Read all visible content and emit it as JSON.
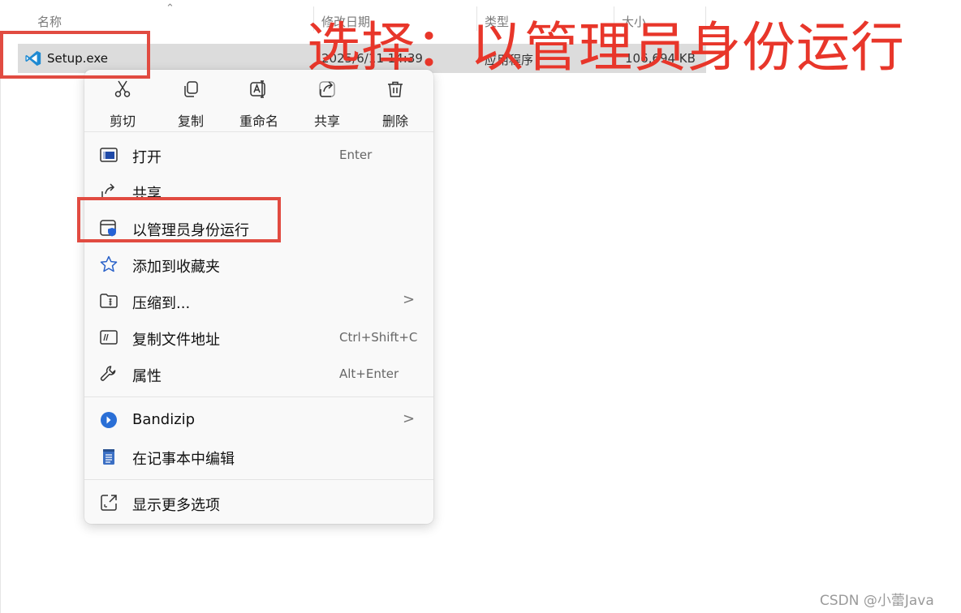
{
  "columns": {
    "name": "名称",
    "modified": "修改日期",
    "type": "类型",
    "size": "大小"
  },
  "file": {
    "name": "Setup.exe",
    "modified": "2025/6/11 14:39",
    "type": "应用程序",
    "size": "106,694 KB",
    "icon": "vscode-icon"
  },
  "annotation": "选择：以管理员身份运行",
  "quick_actions": [
    {
      "label": "剪切",
      "icon": "cut-icon"
    },
    {
      "label": "复制",
      "icon": "copy-icon"
    },
    {
      "label": "重命名",
      "icon": "rename-icon"
    },
    {
      "label": "共享",
      "icon": "share-icon"
    },
    {
      "label": "删除",
      "icon": "delete-icon"
    }
  ],
  "menu_items": [
    {
      "label": "打开",
      "shortcut": "Enter",
      "icon": "open-icon"
    },
    {
      "label": "共享",
      "shortcut": "",
      "icon": "share-icon"
    },
    {
      "label": "以管理员身份运行",
      "shortcut": "",
      "icon": "admin-shield-icon"
    },
    {
      "label": "添加到收藏夹",
      "shortcut": "",
      "icon": "star-icon"
    },
    {
      "label": "压缩到...",
      "shortcut": "",
      "icon": "zip-folder-icon",
      "submenu": ">"
    },
    {
      "label": "复制文件地址",
      "shortcut": "Ctrl+Shift+C",
      "icon": "copy-path-icon"
    },
    {
      "label": "属性",
      "shortcut": "Alt+Enter",
      "icon": "wrench-icon"
    },
    {
      "label": "Bandizip",
      "shortcut": "",
      "icon": "bandizip-icon",
      "submenu": ">"
    },
    {
      "label": "在记事本中编辑",
      "shortcut": "",
      "icon": "notepad-icon"
    },
    {
      "label": "显示更多选项",
      "shortcut": "",
      "icon": "more-options-icon"
    }
  ],
  "colors": {
    "highlight_red": "#e14b41",
    "annotation_red": "#e8362a",
    "vscode_blue": "#1f8ad2",
    "bandizip_blue": "#2a6fd6"
  },
  "watermark": "CSDN @小蕾Java"
}
